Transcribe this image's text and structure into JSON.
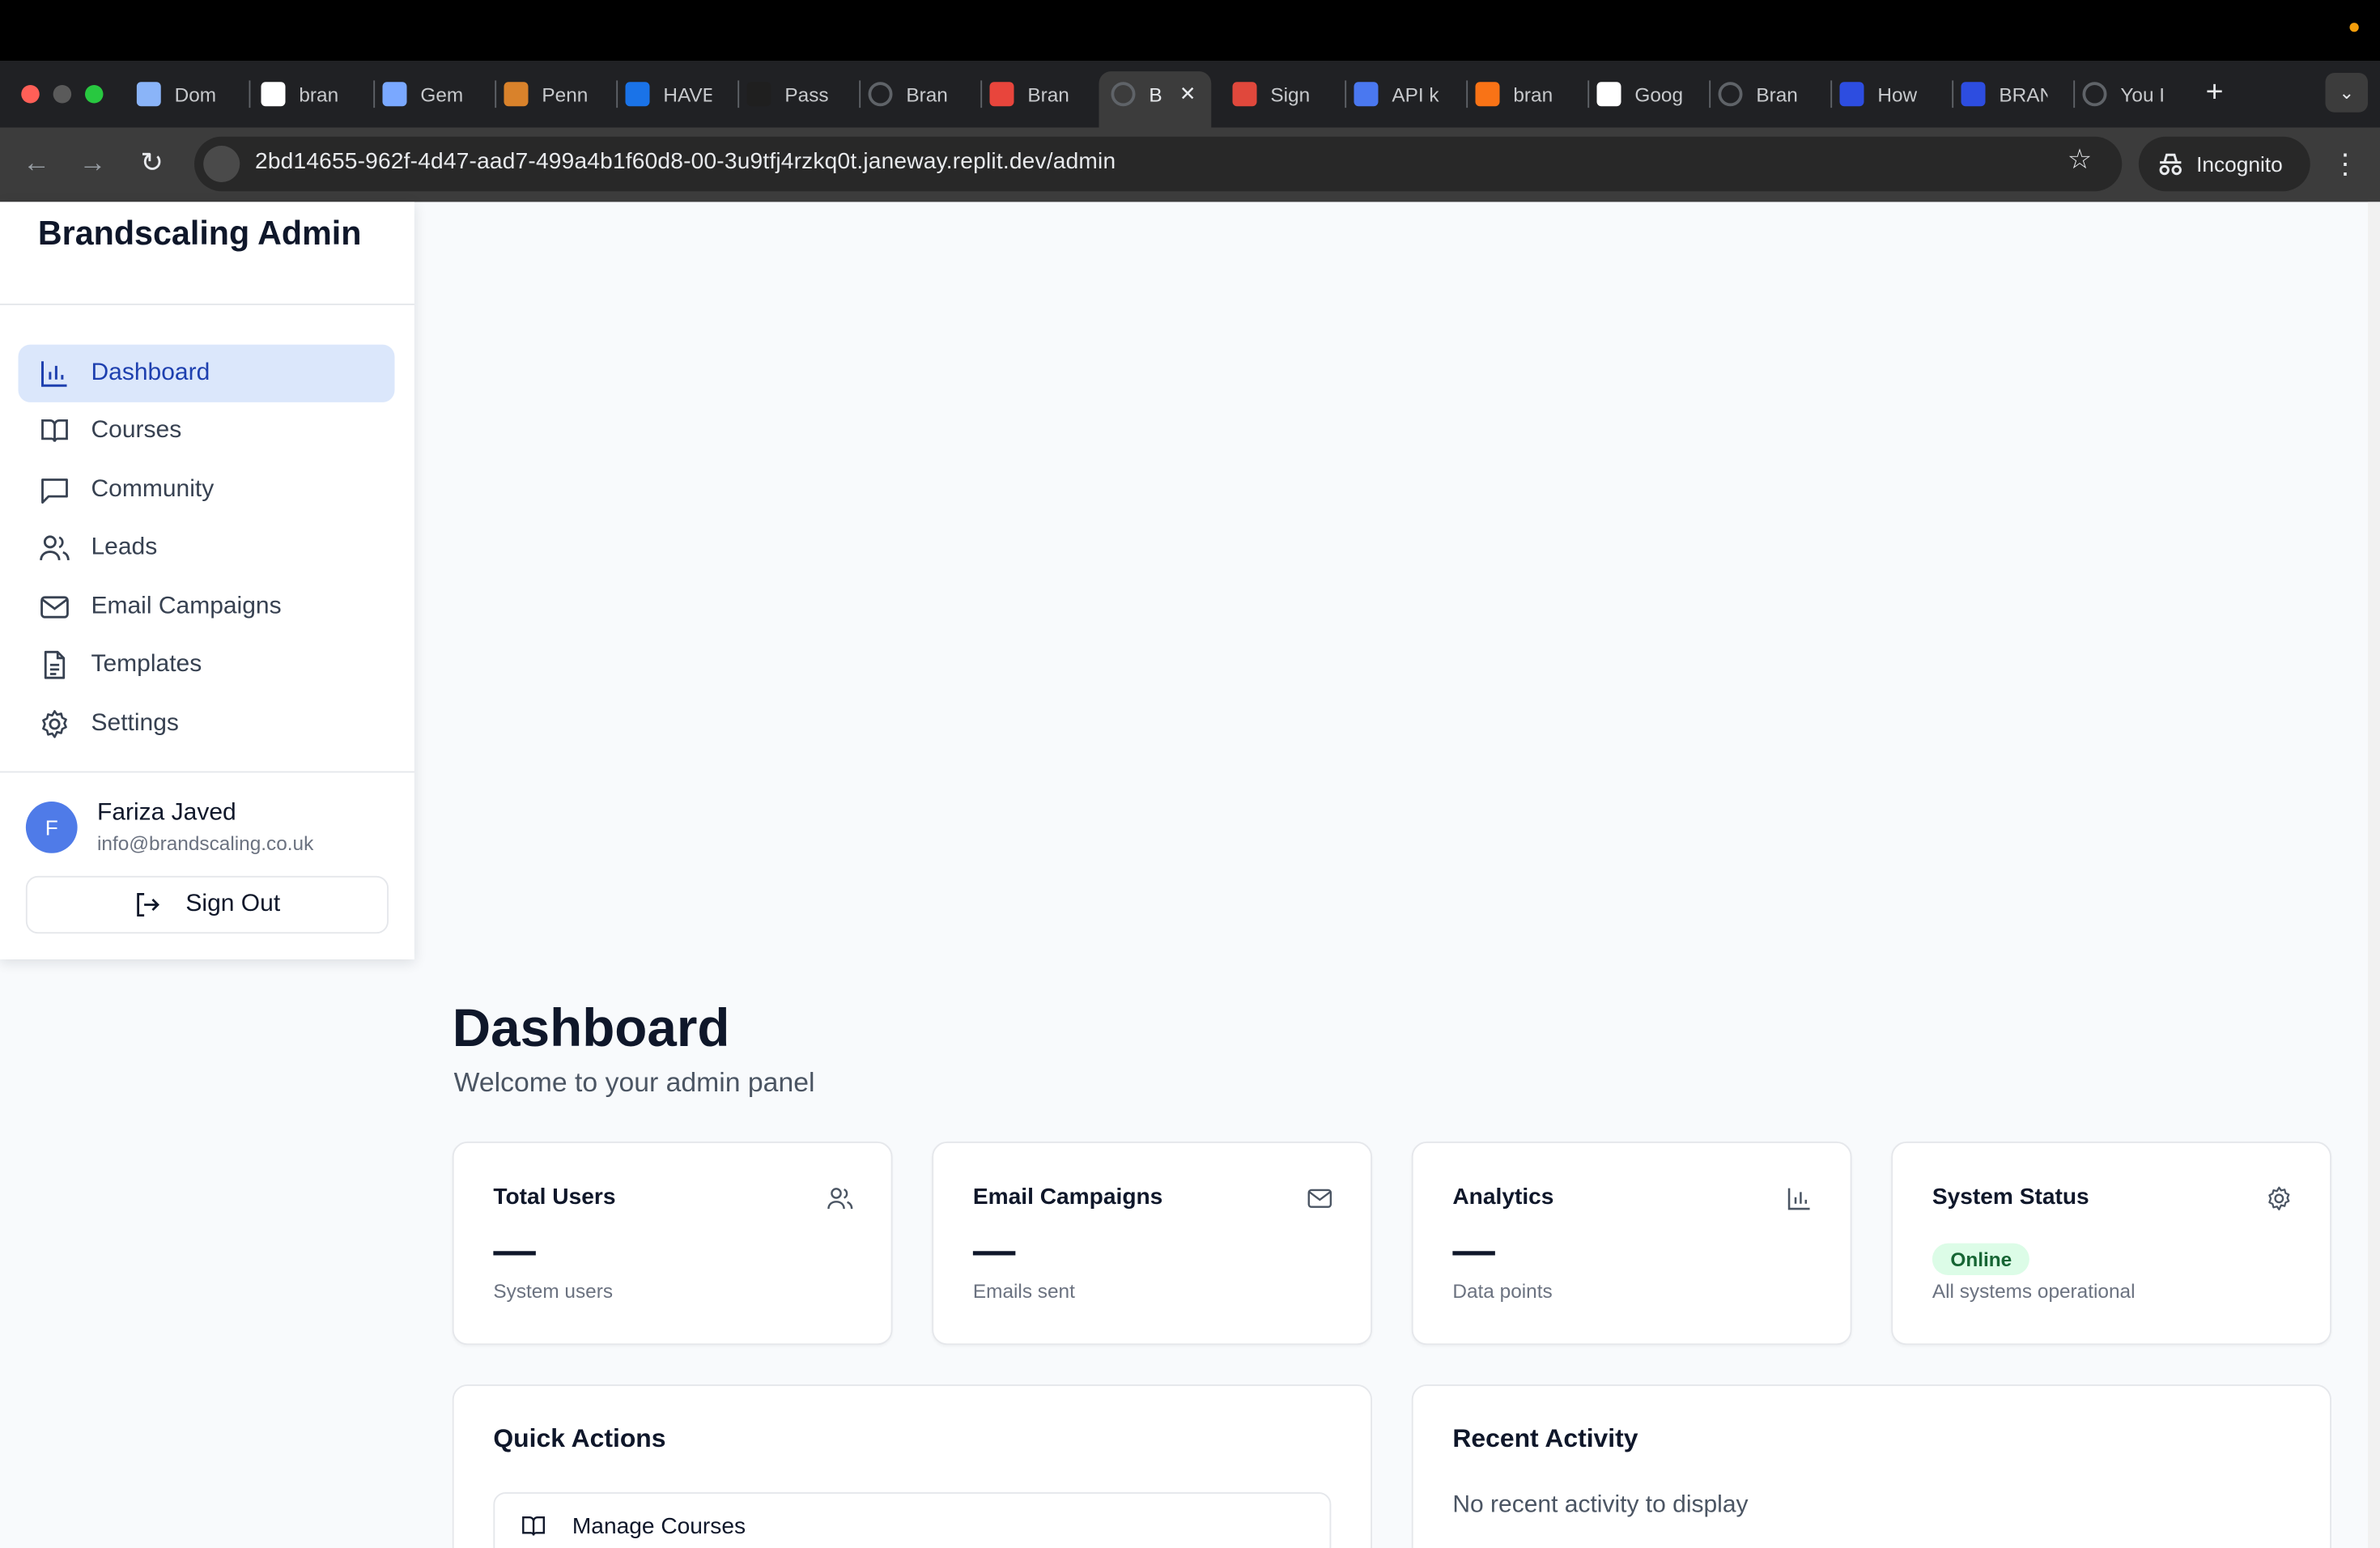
{
  "browser": {
    "tabs": [
      {
        "label": "Dom",
        "favicon": "swirl-icon",
        "color": "#8ab4f8"
      },
      {
        "label": "bran",
        "favicon": "doc-icon",
        "color": "#ffffff"
      },
      {
        "label": "Gem",
        "favicon": "sparkle-icon",
        "color": "#7aa8ff"
      },
      {
        "label": "Penn",
        "favicon": "character-icon",
        "color": "#d9822b"
      },
      {
        "label": "HAVE",
        "favicon": "dropbox-icon",
        "color": "#1a73e8"
      },
      {
        "label": "Pass",
        "favicon": "upwork-icon",
        "color": "#1f1f1f"
      },
      {
        "label": "Bran",
        "favicon": "globe-icon",
        "color": "#5f6368"
      },
      {
        "label": "Bran",
        "favicon": "dots-icon",
        "color": "#e8453c"
      },
      {
        "label": "B",
        "favicon": "globe-icon",
        "color": "#5f6368",
        "active": true
      },
      {
        "label": "Sign",
        "favicon": "asana-icon",
        "color": "#e0483c"
      },
      {
        "label": "API k",
        "favicon": "openai-icon",
        "color": "#4a78f0"
      },
      {
        "label": "bran",
        "favicon": "flame-icon",
        "color": "#f97316"
      },
      {
        "label": "Goog",
        "favicon": "google-icon",
        "color": "#ffffff"
      },
      {
        "label": "Bran",
        "favicon": "globe-icon",
        "color": "#5f6368"
      },
      {
        "label": "How",
        "favicon": "arrow-icon",
        "color": "#2d4de0"
      },
      {
        "label": "BRAN",
        "favicon": "arrow-icon",
        "color": "#2d4de0"
      },
      {
        "label": "You I",
        "favicon": "globe-icon",
        "color": "#5f6368"
      }
    ],
    "url": "2bd14655-962f-4d47-aad7-499a4b1f60d8-00-3u9tfj4rzkq0t.janeway.replit.dev/admin",
    "incognito_label": "Incognito"
  },
  "sidebar": {
    "brand": "Brandscaling Admin",
    "items": [
      {
        "label": "Dashboard",
        "icon": "bar-chart-icon",
        "active": true
      },
      {
        "label": "Courses",
        "icon": "book-icon"
      },
      {
        "label": "Community",
        "icon": "message-icon"
      },
      {
        "label": "Leads",
        "icon": "users-icon"
      },
      {
        "label": "Email Campaigns",
        "icon": "mail-icon"
      },
      {
        "label": "Templates",
        "icon": "file-text-icon"
      },
      {
        "label": "Settings",
        "icon": "gear-icon"
      }
    ],
    "user": {
      "initial": "F",
      "name": "Fariza Javed",
      "email": "info@brandscaling.co.uk"
    },
    "sign_out": "Sign Out"
  },
  "main": {
    "title": "Dashboard",
    "subtitle": "Welcome to your admin panel",
    "stats": [
      {
        "title": "Total Users",
        "value": "—",
        "foot": "System users",
        "icon": "users-icon"
      },
      {
        "title": "Email Campaigns",
        "value": "—",
        "foot": "Emails sent",
        "icon": "mail-icon"
      },
      {
        "title": "Analytics",
        "value": "—",
        "foot": "Data points",
        "icon": "bar-chart-icon"
      },
      {
        "title": "System Status",
        "badge": "Online",
        "foot": "All systems operational",
        "icon": "gear-icon"
      }
    ],
    "quick_actions": {
      "title": "Quick Actions",
      "items": [
        {
          "label": "Manage Courses",
          "icon": "book-icon"
        }
      ]
    },
    "recent_activity": {
      "title": "Recent Activity",
      "empty": "No recent activity to display"
    }
  },
  "colors": {
    "accent": "#1e40af",
    "active_bg": "#dbe7fb",
    "online": "#166534",
    "avatar": "#4f7be8"
  }
}
